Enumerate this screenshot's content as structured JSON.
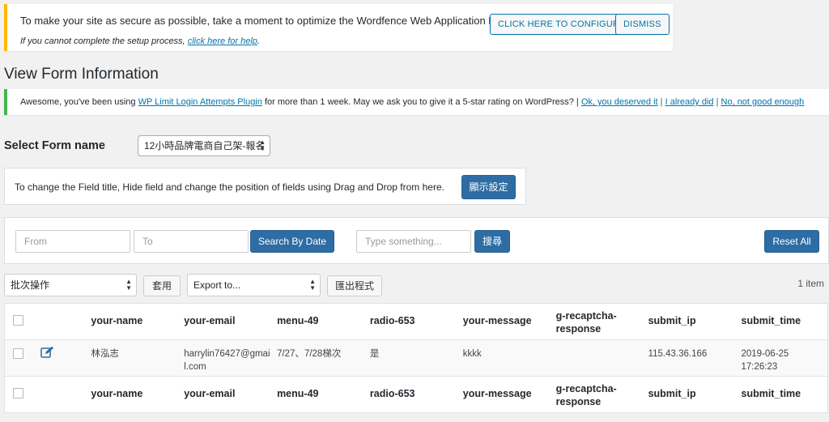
{
  "waf_notice": {
    "message": "To make your site as secure as possible, take a moment to optimize the Wordfence Web Application Firewall:",
    "configure_button": "CLICK HERE TO CONFIGURE",
    "dismiss_button": "DISMISS",
    "help_prefix": "If you cannot complete the setup process,",
    "help_link": "click here for help",
    "help_suffix": "."
  },
  "page_title": "View Form Information",
  "llar_notice": {
    "text_before": "Awesome, you've been using",
    "plugin_link": "WP Limit Login Attempts Plugin",
    "text_after": "for more than 1 week. May we ask you to give it a 5-star rating on WordPress? |",
    "link_ok": "Ok, you deserved it",
    "link_did": "I already did",
    "link_no": "No, not good enough",
    "separator": "|"
  },
  "form_select": {
    "label": "Select Form name",
    "value": "12小時品牌電商自己架-報名"
  },
  "help_panel": {
    "text": "To change the Field title, Hide field and change the position of fields using Drag and Drop from here.",
    "button": "顯示設定"
  },
  "search_panel": {
    "from_placeholder": "From",
    "to_placeholder": "To",
    "search_date_button": "Search By Date",
    "keyword_placeholder": "Type something...",
    "search_button": "搜尋",
    "reset_button": "Reset All"
  },
  "bulk": {
    "bulk_select": "批次操作",
    "apply_button": "套用",
    "export_select": "Export to...",
    "export_button": "匯出程式",
    "item_count": "1 item"
  },
  "table": {
    "columns": [
      "your-name",
      "your-email",
      "menu-49",
      "radio-653",
      "your-message",
      "g-recaptcha-response",
      "submit_ip",
      "submit_time"
    ],
    "rows": [
      {
        "your_name": "林泓志",
        "your_email": "harrylin76427@gmail.com",
        "menu_49": "7/27、7/28梯次",
        "radio_653": "是",
        "your_message": "kkkk",
        "g_recaptcha_response": "",
        "submit_ip": "115.43.36.166",
        "submit_time": "2019-06-25 17:26:23"
      }
    ]
  },
  "colors": {
    "primary_button": "#2e6da4",
    "wp_link": "#0073aa",
    "notice_warning": "#ffb900",
    "notice_success": "#46b450"
  },
  "icons": {
    "edit": "edit-icon"
  }
}
